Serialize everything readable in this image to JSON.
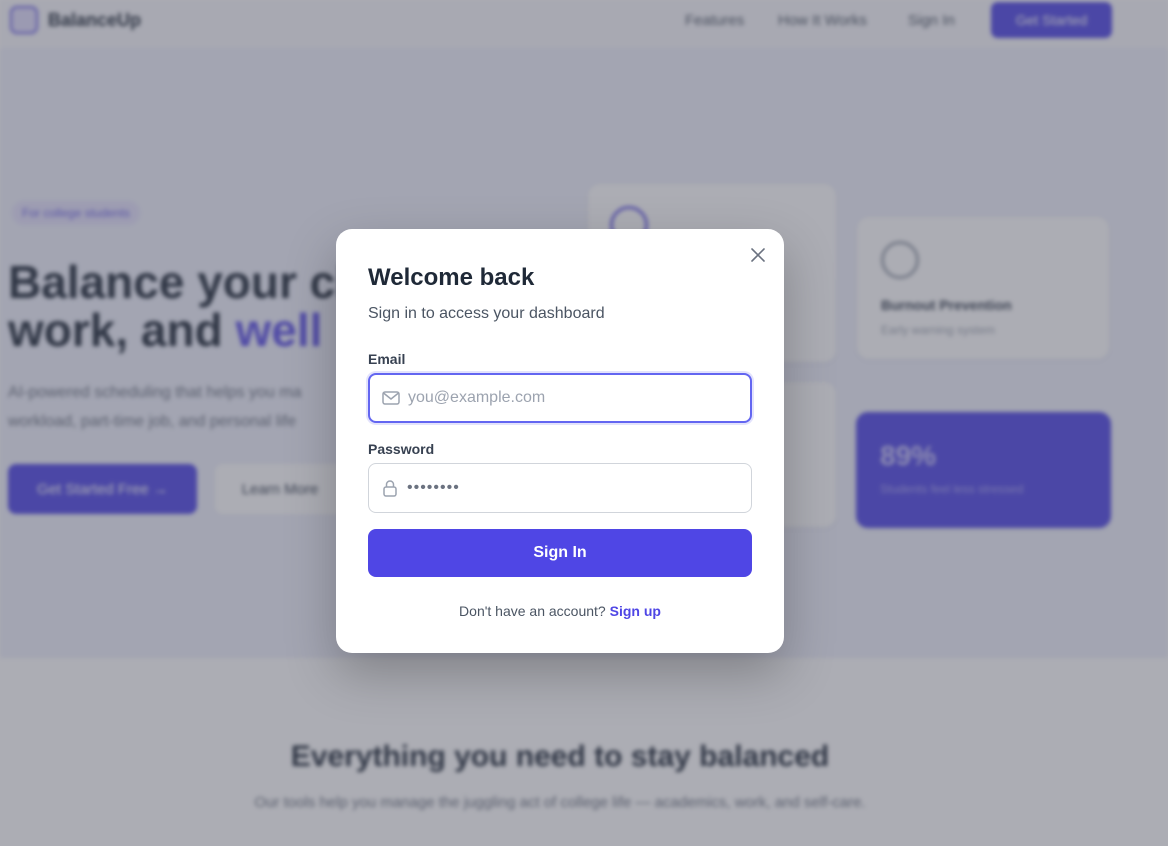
{
  "nav": {
    "logo": "BalanceUp",
    "links": [
      "Features",
      "How It Works",
      "Sign In"
    ],
    "cta": "Get Started"
  },
  "hero": {
    "badge": "For college students",
    "title_line1": "Balance your cl",
    "title_line2_start": "work, and ",
    "title_line2_accent": "well",
    "subtitle": "AI-powered scheduling that helps you ma workload, part-time job, and personal life",
    "primary_button": "Get Started Free →",
    "secondary_button": "Learn More"
  },
  "cards": {
    "burnout": {
      "title": "Burnout Prevention",
      "desc": "Early warning system"
    },
    "stat": {
      "value": "89%",
      "label": "Students feel less stressed"
    }
  },
  "section2": {
    "title": "Everything you need to stay balanced",
    "subtitle": "Our tools help you manage the juggling act of college life — academics, work, and self-care."
  },
  "modal": {
    "title": "Welcome back",
    "subtitle": "Sign in to access your dashboard",
    "email_label": "Email",
    "email_placeholder": "you@example.com",
    "email_value": "",
    "password_label": "Password",
    "password_value": "••••••••",
    "submit_label": "Sign In",
    "signup_prompt": "Don't have an account?",
    "signup_link": "Sign up",
    "icons": {
      "close": "close-icon",
      "email": "mail-icon",
      "password": "lock-icon"
    }
  },
  "colors": {
    "accent": "#4f46e5",
    "focus_ring": "#6366f1",
    "overlay": "rgba(70,74,88,0.45)"
  }
}
